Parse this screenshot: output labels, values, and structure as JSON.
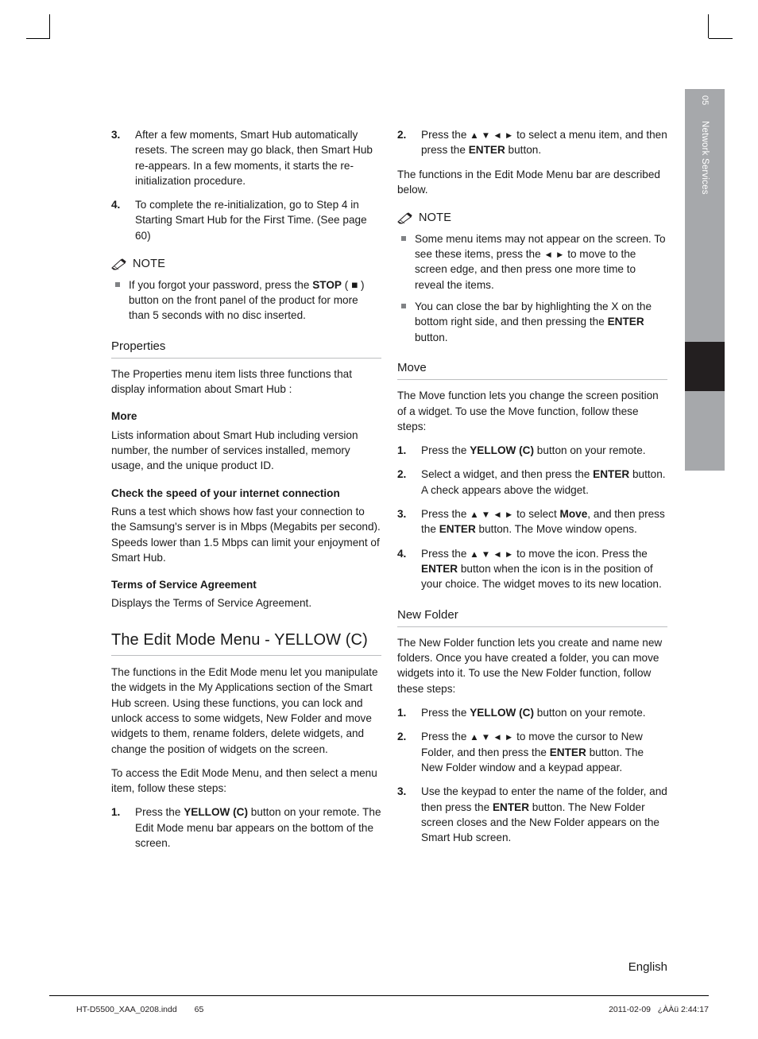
{
  "side_tab": {
    "chapter_number": "05",
    "chapter_title": "Network Services"
  },
  "left_column": {
    "step3": {
      "num": "3.",
      "text": "After a few moments, Smart Hub automatically resets. The screen may go black, then Smart Hub re-appears. In a few moments, it starts the re-initialization procedure."
    },
    "step4": {
      "num": "4.",
      "text": "To complete the re-initialization, go to Step 4 in Starting Smart Hub for the First Time. (See page 60)"
    },
    "note_label": "NOTE",
    "note_item_1_a": "If you forgot your password, press the ",
    "note_item_1_stop": "STOP",
    "note_item_1_b": " ( ■ ) button on the front panel of the product for more than 5 seconds with no disc inserted.",
    "properties_heading": "Properties",
    "properties_text": "The Properties menu item lists three functions that display information about Smart Hub :",
    "more_heading": "More",
    "more_text": "Lists information about Smart Hub including version number, the number of services installed, memory usage, and the unique product ID.",
    "speed_heading": "Check the speed of your internet connection",
    "speed_text_1": "Runs a test which shows how fast your connection to the Samsung's server is in Mbps (Megabits per second).",
    "speed_text_2": "Speeds lower than 1.5 Mbps can limit your enjoyment of Smart Hub.",
    "terms_heading": "Terms of Service Agreement",
    "terms_text": "Displays the Terms of Service Agreement.",
    "edit_mode_heading": "The Edit Mode Menu - YELLOW (C)",
    "edit_mode_text_1": "The functions in the Edit Mode menu let you manipulate the widgets in the My Applications section of the Smart Hub screen. Using these functions, you can lock and unlock access to some widgets, New Folder and move widgets to them, rename folders, delete widgets, and change the position of widgets on the screen.",
    "edit_mode_text_2": "To access the Edit Mode Menu, and then select a menu item, follow these steps:",
    "em_step1": {
      "num": "1.",
      "a": "Press the ",
      "bold": "YELLOW (C)",
      "b": " button on your remote. The Edit Mode menu bar appears on the bottom of the screen."
    }
  },
  "right_column": {
    "step2": {
      "num": "2.",
      "a": "Press the ",
      "arrows": "▲ ▼ ◄ ►",
      "b": " to select a menu item, and then press the ",
      "bold": "ENTER",
      "c": " button."
    },
    "intro_text": "The functions in the Edit Mode Menu bar are described below.",
    "note_label": "NOTE",
    "note_item_1_a": "Some menu items may not appear on the screen. To see these items, press the ",
    "note_item_1_arrows": "◄ ►",
    "note_item_1_b": " to move to the screen edge, and then press one more time to reveal the items.",
    "note_item_2_a": "You can close the bar by highlighting the X on the bottom right side, and then pressing the ",
    "note_item_2_bold": "ENTER",
    "note_item_2_b": " button.",
    "move_heading": "Move",
    "move_text": "The Move function lets you change the screen position of a widget. To use the Move function, follow these steps:",
    "move_step1": {
      "num": "1.",
      "a": "Press the ",
      "bold": "YELLOW (C)",
      "b": " button on your remote."
    },
    "move_step2": {
      "num": "2.",
      "a": "Select a widget, and then press the ",
      "bold": "ENTER",
      "b": " button. A check appears above the widget."
    },
    "move_step3": {
      "num": "3.",
      "a": "Press the ",
      "arrows": "▲ ▼ ◄ ►",
      "b": " to select ",
      "bold1": "Move",
      "c": ", and then press the ",
      "bold2": "ENTER",
      "d": " button. The Move window opens."
    },
    "move_step4": {
      "num": "4.",
      "a": "Press the ",
      "arrows": "▲ ▼ ◄ ►",
      "b": " to move the icon. Press the ",
      "bold": "ENTER",
      "c": " button when the icon is in the position of your choice. The widget moves to its new location."
    },
    "newfolder_heading": "New Folder",
    "newfolder_text": "The New Folder function lets you create and name new folders. Once you have created a folder, you can move widgets into it. To use the New Folder function, follow these steps:",
    "nf_step1": {
      "num": "1.",
      "a": "Press the ",
      "bold": "YELLOW (C)",
      "b": " button on your remote."
    },
    "nf_step2": {
      "num": "2.",
      "a": "Press the ",
      "arrows": "▲ ▼ ◄ ►",
      "b": " to move the cursor to New Folder, and then press the ",
      "bold": "ENTER",
      "c": " button. The New Folder window and a keypad appear."
    },
    "nf_step3": {
      "num": "3.",
      "a": "Use the keypad to enter the name of the folder, and then press the ",
      "bold": "ENTER",
      "b": " button. The New Folder screen closes and the New Folder appears on the Smart Hub screen."
    }
  },
  "footer": {
    "language": "English",
    "file_name": "HT-D5500_XAA_0208.indd",
    "page_number": "65",
    "date": "2011-02-09",
    "time": "¿ÀÀü 2:44:17"
  }
}
